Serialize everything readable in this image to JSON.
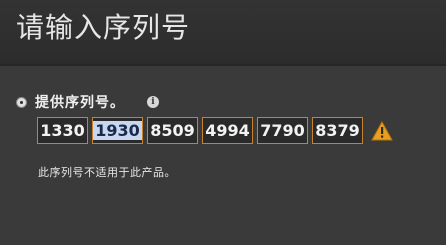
{
  "window": {
    "title": "请输入序列号"
  },
  "option": {
    "label": "提供序列号。",
    "info_icon": "info-icon",
    "selected": true
  },
  "serial": {
    "fields": [
      "1330",
      "1930",
      "8509",
      "4994",
      "7790",
      "8379"
    ],
    "selected_index": 1,
    "warning_icon": "warning-triangle-icon"
  },
  "error": {
    "message": "此序列号不适用于此产品。"
  },
  "colors": {
    "background": "#3a3a3a",
    "field_border": "#c8822a",
    "warning": "#e8a020",
    "selection": "#c7d7f0"
  }
}
